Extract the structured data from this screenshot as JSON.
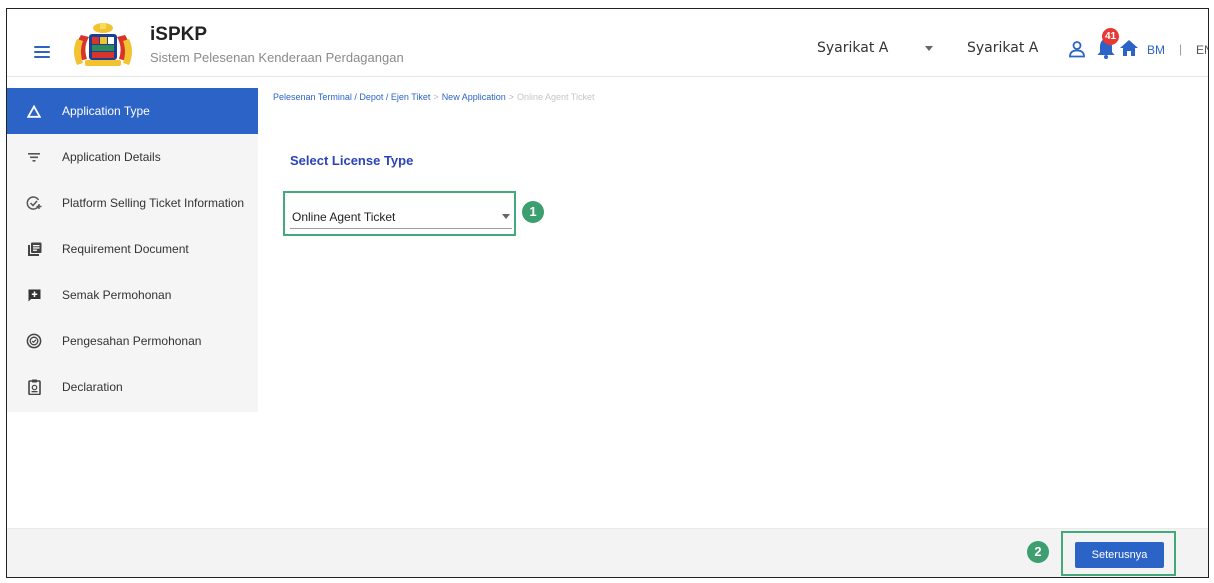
{
  "header": {
    "app_title": "iSPKP",
    "app_subtitle": "Sistem Pelesenan Kenderaan Perdagangan",
    "company_selector": "Syarikat A",
    "company_name": "Syarikat A",
    "notification_count": "41",
    "lang_bm": "BM",
    "lang_separator": "|",
    "lang_en": "EN"
  },
  "sidebar": {
    "items": [
      {
        "label": "Application Type",
        "icon": "triangle-icon",
        "active": true
      },
      {
        "label": "Application Details",
        "icon": "filter-icon",
        "active": false
      },
      {
        "label": "Platform Selling Ticket Information",
        "icon": "check-circle-plus-icon",
        "active": false
      },
      {
        "label": "Requirement Document",
        "icon": "library-books-icon",
        "active": false
      },
      {
        "label": "Semak Permohonan",
        "icon": "add-comment-icon",
        "active": false
      },
      {
        "label": "Pengesahan Permohonan",
        "icon": "check-circle-outline-icon",
        "active": false
      },
      {
        "label": "Declaration",
        "icon": "clipboard-icon",
        "active": false
      }
    ]
  },
  "breadcrumb": {
    "items": [
      "Pelesenan Terminal / Depot / Ejen Tiket",
      "New Application",
      "Online Agent Ticket"
    ],
    "separator": ">"
  },
  "main": {
    "section_title": "Select License Type",
    "license_type_value": "Online Agent Ticket"
  },
  "steps": [
    "1",
    "2"
  ],
  "footer": {
    "next_label": "Seterusnya"
  },
  "colors": {
    "primary": "#2c63c7",
    "highlight_border": "#43a97b",
    "step_badge": "#3d9e70",
    "notification_badge": "#e53935"
  }
}
